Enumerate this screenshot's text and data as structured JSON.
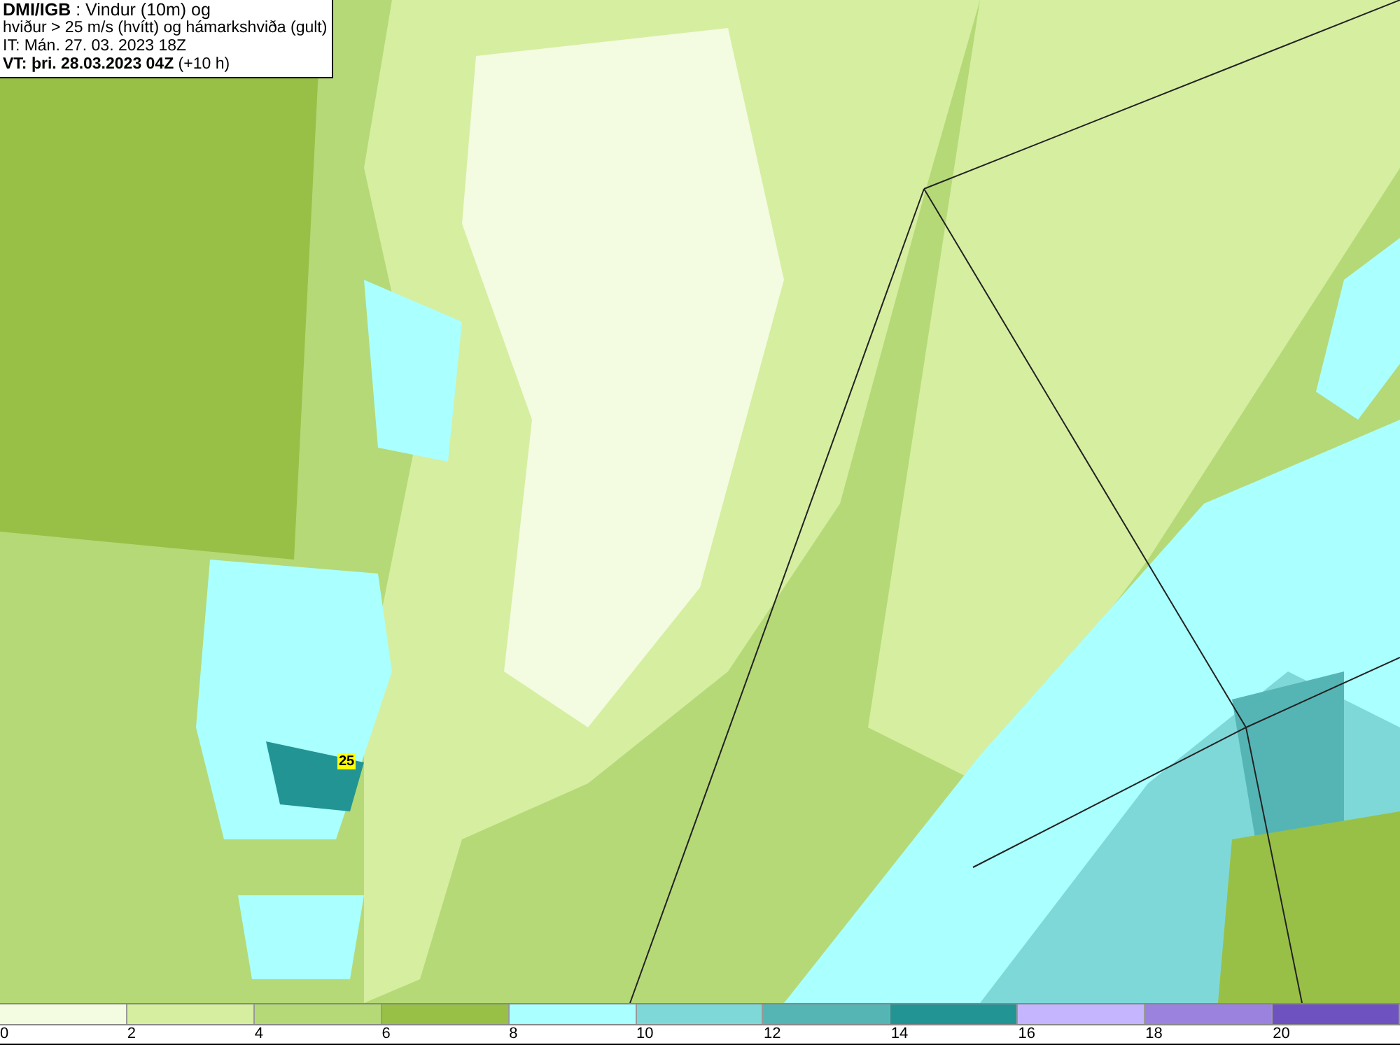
{
  "title_box": {
    "lines": [
      "**DMI/IGB** : Vindur (10m) og",
      "hviður > 25 m/s (hvítt) og hámarkshviða (gult)",
      "IT: Mán. 27. 03. 2023 18Z",
      "**VT: þri. 28.03.2023 04Z** (+10 h)"
    ]
  },
  "map": {
    "gust_marker": "25"
  },
  "legend": {
    "bins": [
      {
        "color": "#f3fbe0"
      },
      {
        "color": "#d6eea0"
      },
      {
        "color": "#b5d977"
      },
      {
        "color": "#98c046"
      },
      {
        "color": "#aaffff"
      },
      {
        "color": "#7fd8d8"
      },
      {
        "color": "#55b5b5"
      },
      {
        "color": "#239494"
      },
      {
        "color": "#c5b5ff"
      },
      {
        "color": "#9a82de"
      },
      {
        "color": "#6e52c0"
      }
    ],
    "ticks": [
      "0",
      "2",
      "4",
      "6",
      "8",
      "10",
      "12",
      "14",
      "16",
      "18",
      "20"
    ]
  }
}
